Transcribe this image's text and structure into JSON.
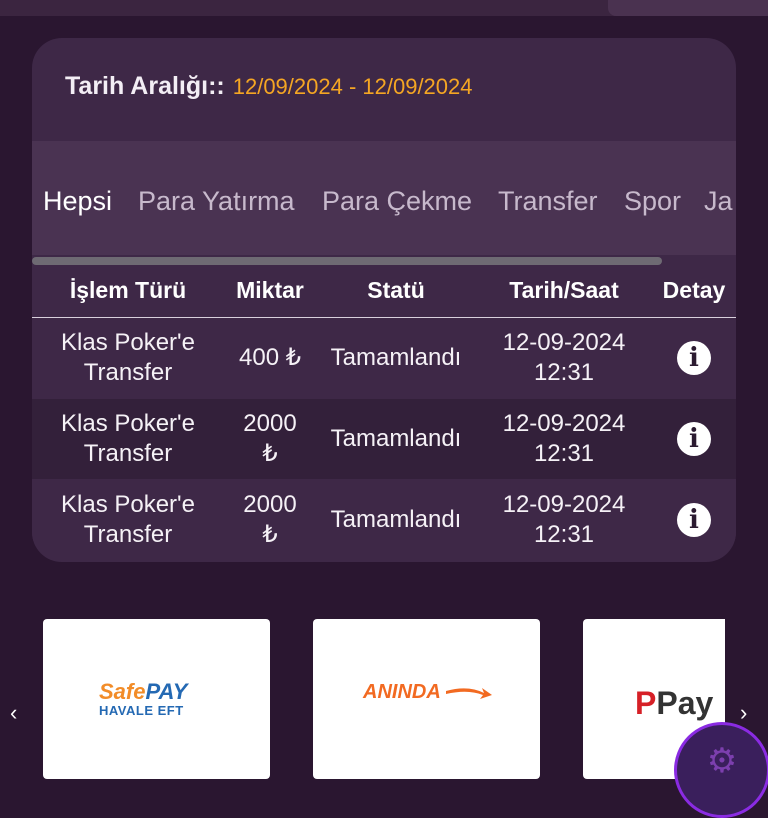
{
  "filter": {
    "label": "Tarih Aralığı::",
    "value": "12/09/2024 - 12/09/2024"
  },
  "tabs": [
    "Hepsi",
    "Para Yatırma",
    "Para Çekme",
    "Transfer",
    "Spor",
    "Ja"
  ],
  "active_tab": "Hepsi",
  "table": {
    "headers": [
      "İşlem Türü",
      "Miktar",
      "Statü",
      "Tarih/Saat",
      "Detay"
    ],
    "rows": [
      {
        "type_l1": "Klas Poker'e",
        "type_l2": "Transfer",
        "amount_l1": "400 ₺",
        "amount_l2": "",
        "status": "Tamamlandı",
        "date": "12-09-2024",
        "time": "12:31",
        "detail_icon": "info-icon"
      },
      {
        "type_l1": "Klas Poker'e",
        "type_l2": "Transfer",
        "amount_l1": "2000",
        "amount_l2": "₺",
        "status": "Tamamlandı",
        "date": "12-09-2024",
        "time": "12:31",
        "detail_icon": "info-icon"
      },
      {
        "type_l1": "Klas Poker'e",
        "type_l2": "Transfer",
        "amount_l1": "2000",
        "amount_l2": "₺",
        "status": "Tamamlandı",
        "date": "12-09-2024",
        "time": "12:31",
        "detail_icon": "info-icon"
      }
    ]
  },
  "payment_methods": {
    "safepay": {
      "part1": "Safe",
      "part2": "PAY",
      "line2": "HAVALE EFT"
    },
    "aninda": {
      "text": "ANINDA"
    },
    "third": {
      "letter": "P",
      "text": "Pay"
    }
  },
  "colors": {
    "background": "#2a1630",
    "card": "#3e2847",
    "accent_date": "#f5a623",
    "fab_border": "#8a2be2"
  }
}
